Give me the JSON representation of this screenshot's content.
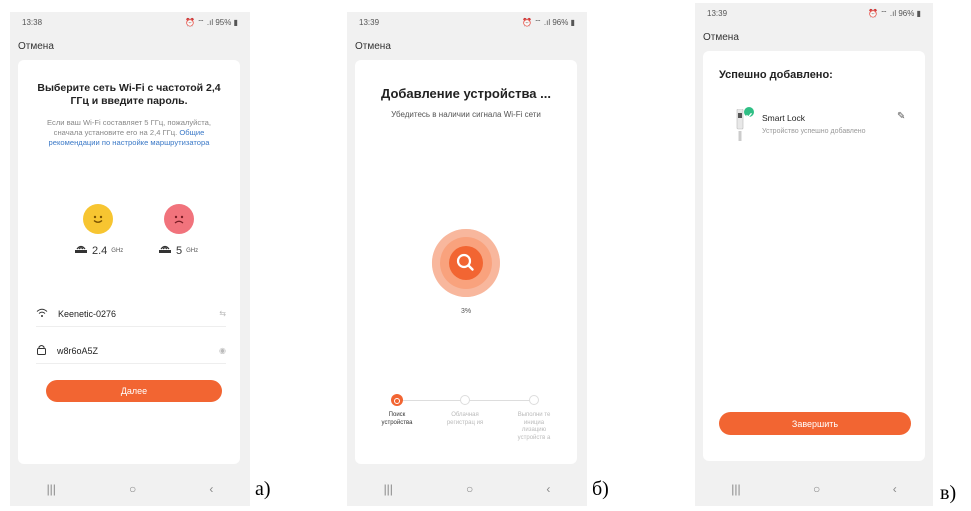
{
  "screens": [
    {
      "status": {
        "time": "13:38",
        "right": "95%"
      },
      "cancel": "Отмена",
      "title": "Выберите сеть Wi-Fi с частотой 2,4 ГГц и введите пароль.",
      "desc": "Если ваш Wi-Fi составляет 5 ГГц, пожалуйста, сначала установите его на 2,4 ГГц.",
      "desc_link": "Общие рекомендации по настройке маршрутизатора",
      "band_24": {
        "value": "2.4",
        "unit": "GHz"
      },
      "band_5": {
        "value": "5",
        "unit": "GHz"
      },
      "wifi_name": "Keenetic-0276",
      "password": "w8r6oA5Z",
      "next_button": "Далее",
      "caption": "а)"
    },
    {
      "status": {
        "time": "13:39",
        "right": "96%"
      },
      "cancel": "Отмена",
      "title": "Добавление устройства ...",
      "subtitle": "Убедитесь в наличии сигнала Wi-Fi сети",
      "progress_text": "3%",
      "progress": 0.03,
      "steps": [
        {
          "label": "Поиск устройства",
          "active": true
        },
        {
          "label": "Облачная регистрац ия",
          "active": false
        },
        {
          "label": "Выполни те инициа лизацию устройств а",
          "active": false
        }
      ],
      "caption": "б)"
    },
    {
      "status": {
        "time": "13:39",
        "right": "96%"
      },
      "cancel": "Отмена",
      "title": "Успешно добавлено:",
      "device_name": "Smart Lock",
      "device_status": "Устройство успешно добавлено",
      "finish_button": "Завершить",
      "caption": "в)"
    }
  ],
  "colors": {
    "accent": "#f26532",
    "accent_light": "#f8b79d",
    "happy": "#f7c531",
    "sad": "#f1737c",
    "success": "#2fbf85"
  },
  "nav_icons": [
    "recent-apps-icon",
    "home-icon",
    "back-icon"
  ]
}
